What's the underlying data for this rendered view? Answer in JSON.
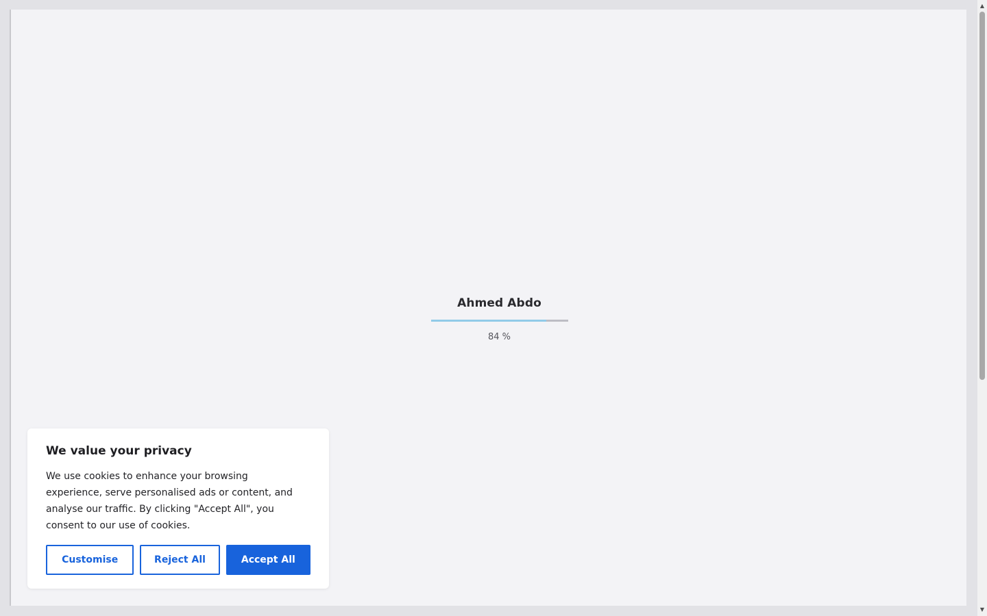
{
  "preloader": {
    "name": "Ahmed Abdo",
    "progress": 84,
    "progress_text": "84 %"
  },
  "cookie_banner": {
    "title": "We value your privacy",
    "body": "We use cookies to enhance your browsing experience, serve personalised ads or content, and analyse our traffic. By clicking \"Accept All\", you consent to our use of cookies.",
    "customise_label": "Customise",
    "reject_label": "Reject All",
    "accept_label": "Accept All"
  },
  "colors": {
    "accent": "#1863dc",
    "progress_fill": "#91cbe8",
    "progress_track": "#bdbdc4",
    "page_background": "#f3f3f6"
  },
  "icons": {
    "scroll_up": "triangle-up-icon",
    "scroll_down": "triangle-down-icon"
  }
}
